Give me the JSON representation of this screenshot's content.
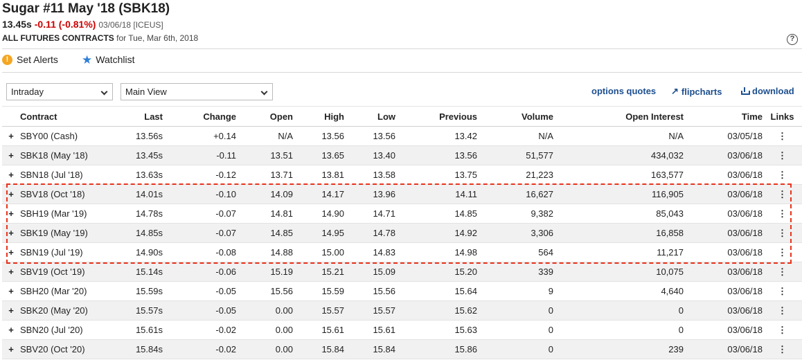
{
  "header": {
    "title": "Sugar #11 May '18 (SBK18)",
    "last": "13.45s",
    "change": "-0.11 (-0.81%)",
    "meta": "03/06/18 [ICEUS]",
    "sub_bold": "ALL FUTURES CONTRACTS",
    "sub_rest": "for Tue, Mar 6th, 2018",
    "help_glyph": "?"
  },
  "actions": {
    "alerts_label": "Set Alerts",
    "watchlist_label": "Watchlist"
  },
  "toolbar": {
    "period_select": "Intraday",
    "view_select": "Main View",
    "options_quotes": "options quotes",
    "flipcharts": "flipcharts",
    "download": "download"
  },
  "table": {
    "columns": {
      "contract": "Contract",
      "last": "Last",
      "change": "Change",
      "open": "Open",
      "high": "High",
      "low": "Low",
      "previous": "Previous",
      "volume": "Volume",
      "open_interest": "Open Interest",
      "time": "Time",
      "links": "Links"
    },
    "rows": [
      {
        "contract": "SBY00 (Cash)",
        "last": "13.56s",
        "change": "+0.14",
        "open": "N/A",
        "high": "13.56",
        "low": "13.56",
        "previous": "13.42",
        "volume": "N/A",
        "oi": "N/A",
        "time": "03/05/18"
      },
      {
        "contract": "SBK18 (May '18)",
        "last": "13.45s",
        "change": "-0.11",
        "open": "13.51",
        "high": "13.65",
        "low": "13.40",
        "previous": "13.56",
        "volume": "51,577",
        "oi": "434,032",
        "time": "03/06/18"
      },
      {
        "contract": "SBN18 (Jul '18)",
        "last": "13.63s",
        "change": "-0.12",
        "open": "13.71",
        "high": "13.81",
        "low": "13.58",
        "previous": "13.75",
        "volume": "21,223",
        "oi": "163,577",
        "time": "03/06/18"
      },
      {
        "contract": "SBV18 (Oct '18)",
        "last": "14.01s",
        "change": "-0.10",
        "open": "14.09",
        "high": "14.17",
        "low": "13.96",
        "previous": "14.11",
        "volume": "16,627",
        "oi": "116,905",
        "time": "03/06/18"
      },
      {
        "contract": "SBH19 (Mar '19)",
        "last": "14.78s",
        "change": "-0.07",
        "open": "14.81",
        "high": "14.90",
        "low": "14.71",
        "previous": "14.85",
        "volume": "9,382",
        "oi": "85,043",
        "time": "03/06/18"
      },
      {
        "contract": "SBK19 (May '19)",
        "last": "14.85s",
        "change": "-0.07",
        "open": "14.85",
        "high": "14.95",
        "low": "14.78",
        "previous": "14.92",
        "volume": "3,306",
        "oi": "16,858",
        "time": "03/06/18"
      },
      {
        "contract": "SBN19 (Jul '19)",
        "last": "14.90s",
        "change": "-0.08",
        "open": "14.88",
        "high": "15.00",
        "low": "14.83",
        "previous": "14.98",
        "volume": "564",
        "oi": "11,217",
        "time": "03/06/18"
      },
      {
        "contract": "SBV19 (Oct '19)",
        "last": "15.14s",
        "change": "-0.06",
        "open": "15.19",
        "high": "15.21",
        "low": "15.09",
        "previous": "15.20",
        "volume": "339",
        "oi": "10,075",
        "time": "03/06/18"
      },
      {
        "contract": "SBH20 (Mar '20)",
        "last": "15.59s",
        "change": "-0.05",
        "open": "15.56",
        "high": "15.59",
        "low": "15.56",
        "previous": "15.64",
        "volume": "9",
        "oi": "4,640",
        "time": "03/06/18"
      },
      {
        "contract": "SBK20 (May '20)",
        "last": "15.57s",
        "change": "-0.05",
        "open": "0.00",
        "high": "15.57",
        "low": "15.57",
        "previous": "15.62",
        "volume": "0",
        "oi": "0",
        "time": "03/06/18"
      },
      {
        "contract": "SBN20 (Jul '20)",
        "last": "15.61s",
        "change": "-0.02",
        "open": "0.00",
        "high": "15.61",
        "low": "15.61",
        "previous": "15.63",
        "volume": "0",
        "oi": "0",
        "time": "03/06/18"
      },
      {
        "contract": "SBV20 (Oct '20)",
        "last": "15.84s",
        "change": "-0.02",
        "open": "0.00",
        "high": "15.84",
        "low": "15.84",
        "previous": "15.86",
        "volume": "0",
        "oi": "239",
        "time": "03/06/18"
      }
    ]
  },
  "colors": {
    "positive": "#2a8a2a",
    "negative": "#cc0000",
    "link": "#1d4f8f",
    "highlight": "#e8331c"
  }
}
